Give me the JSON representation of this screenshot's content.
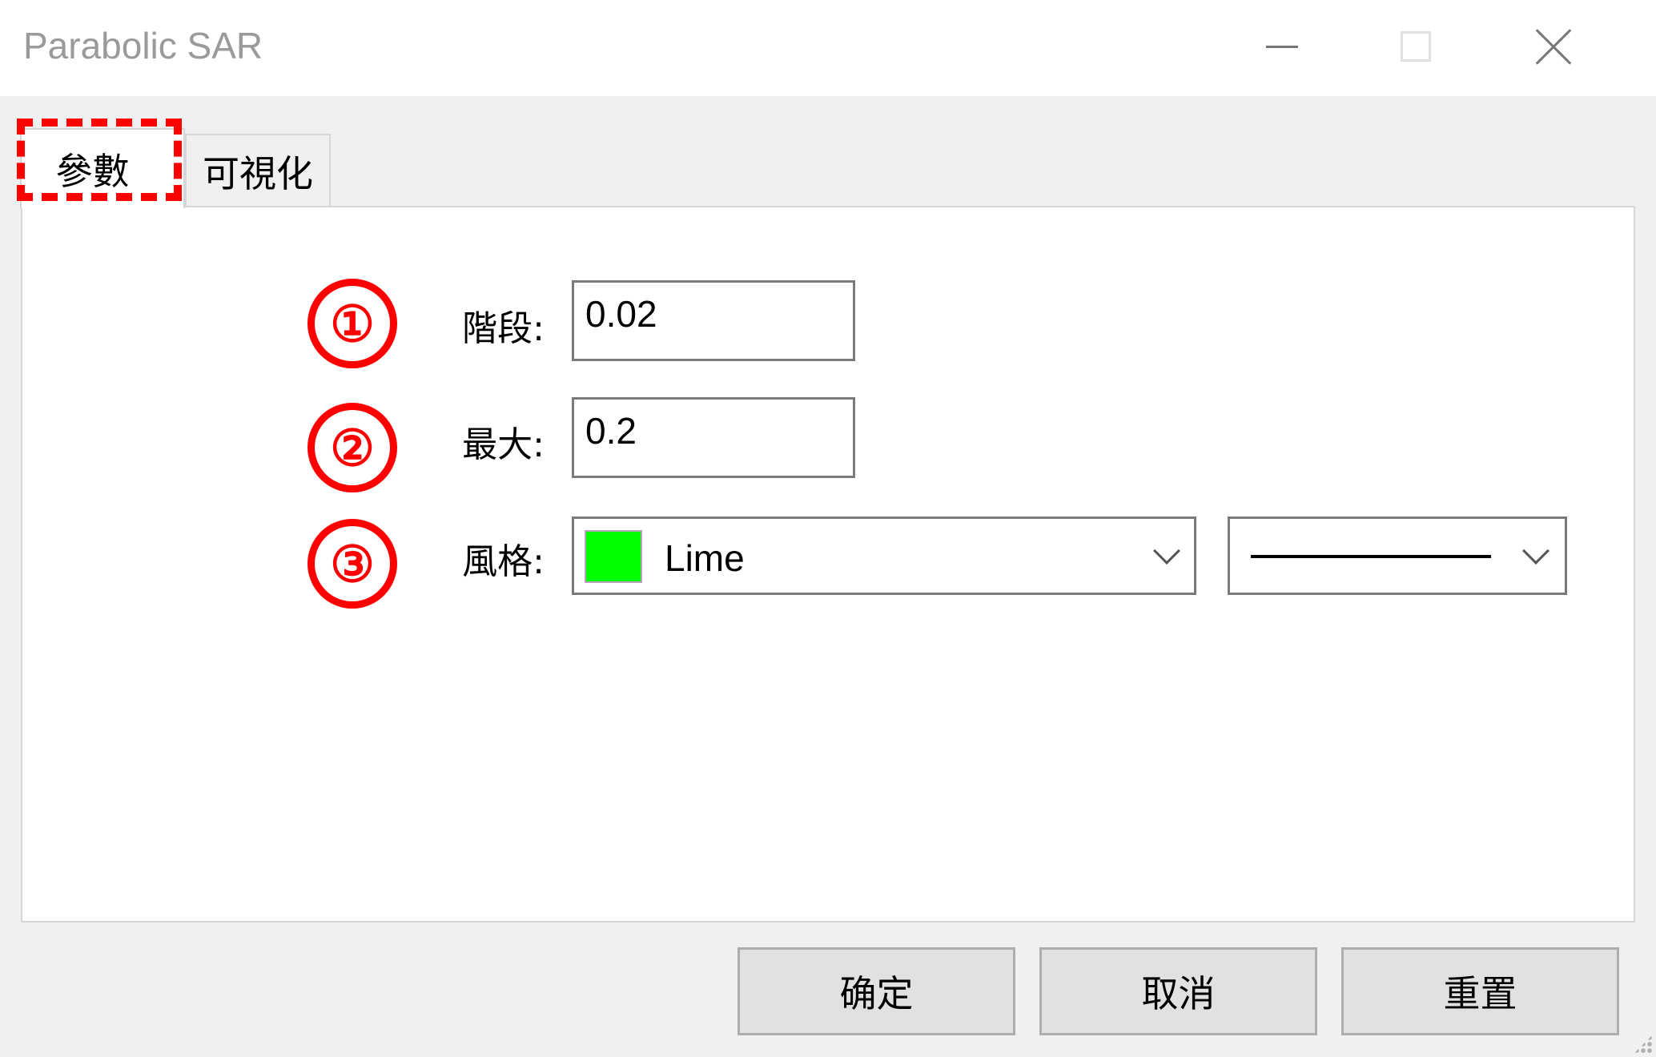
{
  "window": {
    "title": "Parabolic SAR",
    "controls": {
      "minimize": "minimize-icon",
      "maximize": "maximize-icon",
      "close": "close-icon"
    }
  },
  "tabs": [
    {
      "label": "參數",
      "active": true
    },
    {
      "label": "可視化",
      "active": false
    }
  ],
  "annotations": {
    "highlight_color": "#ff0000",
    "markers": [
      "①",
      "②",
      "③"
    ]
  },
  "params": {
    "step": {
      "label": "階段:",
      "value": "0.02"
    },
    "maximum": {
      "label": "最大:",
      "value": "0.2"
    },
    "style": {
      "label": "風格:",
      "color_name": "Lime",
      "color_hex": "#00ff00",
      "line_style": "solid"
    }
  },
  "buttons": {
    "ok": "确定",
    "cancel": "取消",
    "reset": "重置"
  }
}
